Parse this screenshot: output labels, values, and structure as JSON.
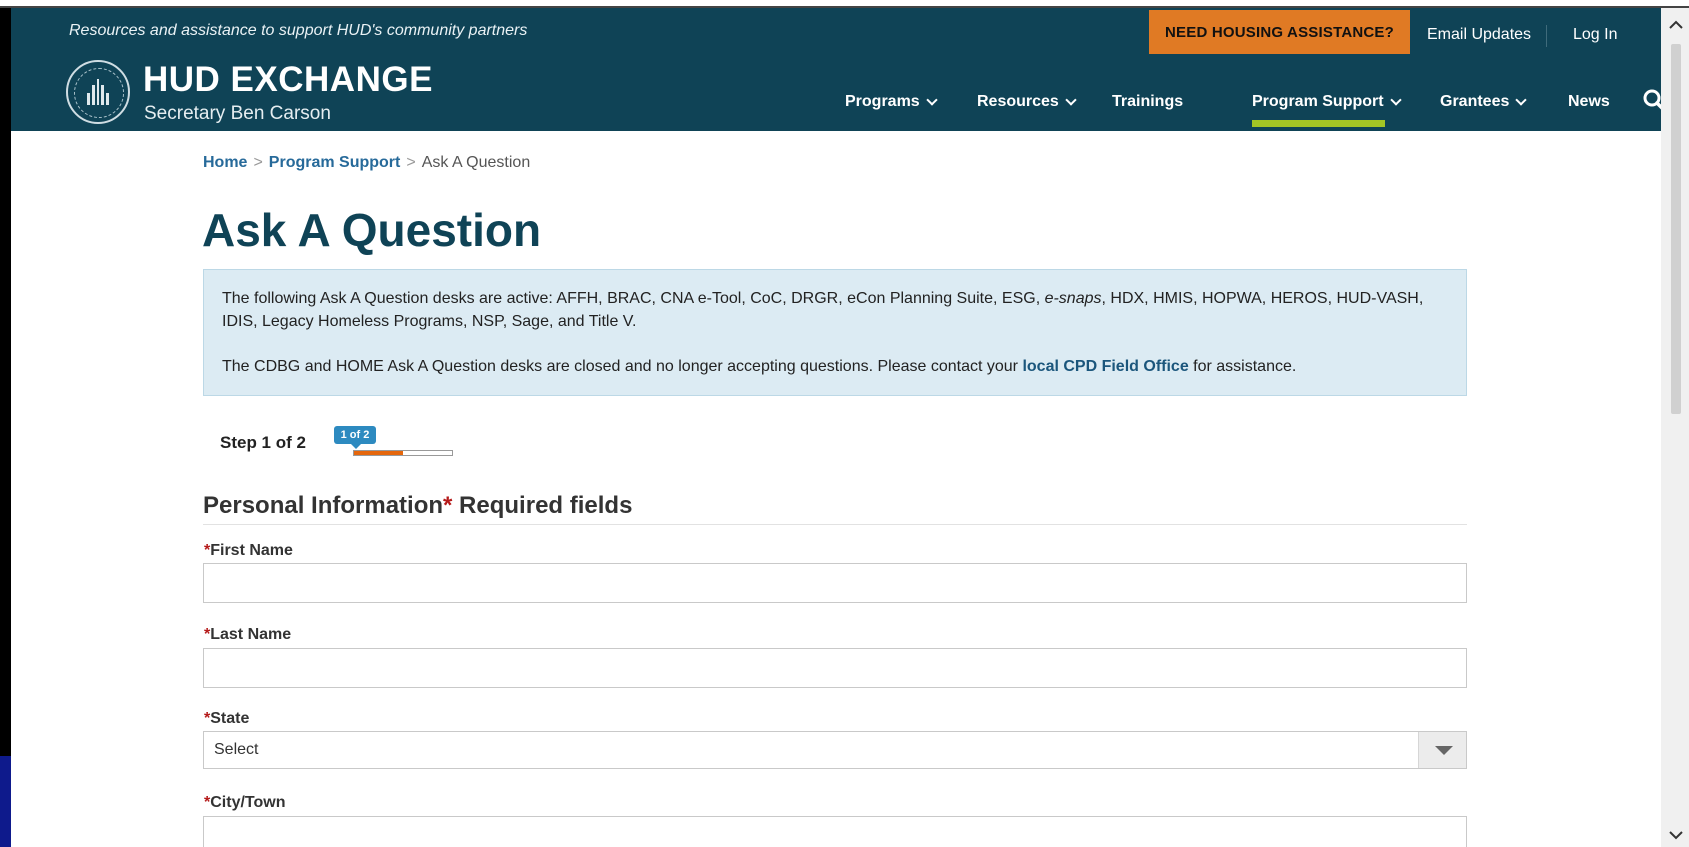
{
  "header": {
    "tagline": "Resources and assistance to support HUD's community partners",
    "need_housing": "NEED HOUSING ASSISTANCE?",
    "email_updates": "Email Updates",
    "login": "Log In",
    "logo_title": "HUD EXCHANGE",
    "logo_subtitle": "Secretary Ben Carson",
    "nav": [
      {
        "label": "Programs",
        "dropdown": true
      },
      {
        "label": "Resources",
        "dropdown": true
      },
      {
        "label": "Trainings",
        "dropdown": false
      },
      {
        "label": "Program Support",
        "dropdown": true,
        "active": true
      },
      {
        "label": "Grantees",
        "dropdown": true
      },
      {
        "label": "News",
        "dropdown": false
      }
    ]
  },
  "breadcrumb": {
    "home": "Home",
    "program_support": "Program Support",
    "current": "Ask A Question",
    "separator": ">"
  },
  "page_title": "Ask A Question",
  "notice": {
    "p1_before": "The following Ask A Question desks are active: AFFH, BRAC, CNA e-Tool, CoC, DRGR, eCon Planning Suite, ESG, ",
    "p1_italic": "e-snaps",
    "p1_after": ", HDX, HMIS, HOPWA, HEROS, HUD-VASH, IDIS, Legacy Homeless Programs, NSP, Sage, and Title V.",
    "p2_before": "The CDBG and HOME Ask A Question desks are closed and no longer accepting questions. Please contact your ",
    "p2_link": "local CPD Field Office",
    "p2_after": " for assistance."
  },
  "step": {
    "label": "Step 1 of 2",
    "badge": "1 of 2",
    "progress": 0.5
  },
  "section": {
    "title": "Personal Information",
    "required_mark": "*",
    "required_text": " Required fields"
  },
  "fields": [
    {
      "label": "First Name",
      "value": "",
      "type": "text"
    },
    {
      "label": "Last Name",
      "value": "",
      "type": "text"
    },
    {
      "label": "State",
      "value": "Select",
      "type": "select"
    },
    {
      "label": "City/Town",
      "value": "",
      "type": "text"
    }
  ],
  "colors": {
    "header_bg": "#0f4356",
    "accent_orange": "#e07a24",
    "nav_active": "#a3c525",
    "link": "#276a9a",
    "notice_bg": "#dcebf3"
  }
}
